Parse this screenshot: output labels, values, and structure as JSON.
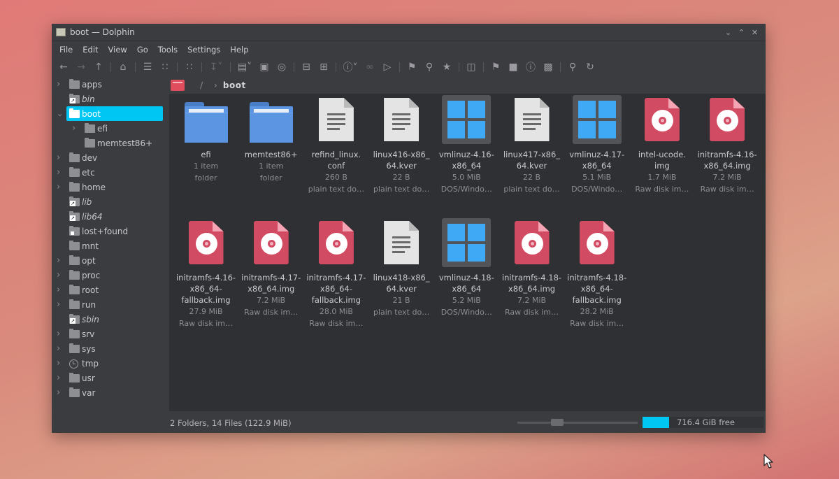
{
  "window": {
    "title": "boot — Dolphin"
  },
  "menu": [
    "File",
    "Edit",
    "View",
    "Go",
    "Tools",
    "Settings",
    "Help"
  ],
  "tree": [
    {
      "label": "apps",
      "expandable": true
    },
    {
      "label": "bin",
      "expandable": false,
      "italic": true
    },
    {
      "label": "boot",
      "expandable": true,
      "selected": true
    },
    {
      "label": "efi",
      "expandable": true,
      "child": true
    },
    {
      "label": "memtest86+",
      "expandable": false,
      "child": true
    },
    {
      "label": "dev",
      "expandable": true
    },
    {
      "label": "etc",
      "expandable": true
    },
    {
      "label": "home",
      "expandable": true
    },
    {
      "label": "lib",
      "expandable": false,
      "italic": true
    },
    {
      "label": "lib64",
      "expandable": false,
      "italic": true
    },
    {
      "label": "lost+found",
      "expandable": false
    },
    {
      "label": "mnt",
      "expandable": false
    },
    {
      "label": "opt",
      "expandable": true
    },
    {
      "label": "proc",
      "expandable": true
    },
    {
      "label": "root",
      "expandable": true
    },
    {
      "label": "run",
      "expandable": true
    },
    {
      "label": "sbin",
      "expandable": false,
      "italic": true
    },
    {
      "label": "srv",
      "expandable": true
    },
    {
      "label": "sys",
      "expandable": true
    },
    {
      "label": "tmp",
      "expandable": true
    },
    {
      "label": "usr",
      "expandable": true
    },
    {
      "label": "var",
      "expandable": true
    }
  ],
  "breadcrumb": {
    "separator": "/",
    "current": "boot"
  },
  "files": [
    {
      "name": [
        "efi"
      ],
      "size": "1 item",
      "type": "folder",
      "icon": "folder"
    },
    {
      "name": [
        "memtest86+"
      ],
      "size": "1 item",
      "type": "folder",
      "icon": "folder"
    },
    {
      "name": [
        "refind_linux.",
        "conf"
      ],
      "size": "260 B",
      "type": "plain text do…",
      "icon": "text"
    },
    {
      "name": [
        "linux416-x86_",
        "64.kver"
      ],
      "size": "22 B",
      "type": "plain text do…",
      "icon": "text"
    },
    {
      "name": [
        "vmlinuz-4.16-",
        "x86_64"
      ],
      "size": "5.0 MiB",
      "type": "DOS/Windo…",
      "icon": "windows"
    },
    {
      "name": [
        "linux417-x86_",
        "64.kver"
      ],
      "size": "22 B",
      "type": "plain text do…",
      "icon": "text"
    },
    {
      "name": [
        "vmlinuz-4.17-",
        "x86_64"
      ],
      "size": "5.1 MiB",
      "type": "DOS/Windo…",
      "icon": "windows"
    },
    {
      "name": [
        "intel-ucode.",
        "img"
      ],
      "size": "1.7 MiB",
      "type": "Raw disk im…",
      "icon": "disk"
    },
    {
      "name": [
        "initramfs-4.16-",
        "x86_64.img"
      ],
      "size": "7.2 MiB",
      "type": "Raw disk im…",
      "icon": "disk"
    },
    {
      "name": [
        "initramfs-4.16-",
        "x86_64-",
        "fallback.img"
      ],
      "size": "27.9 MiB",
      "type": "Raw disk im…",
      "icon": "disk"
    },
    {
      "name": [
        "initramfs-4.17-",
        "x86_64.img"
      ],
      "size": "7.2 MiB",
      "type": "Raw disk im…",
      "icon": "disk"
    },
    {
      "name": [
        "initramfs-4.17-",
        "x86_64-",
        "fallback.img"
      ],
      "size": "28.0 MiB",
      "type": "Raw disk im…",
      "icon": "disk"
    },
    {
      "name": [
        "linux418-x86_",
        "64.kver"
      ],
      "size": "21 B",
      "type": "plain text do…",
      "icon": "text"
    },
    {
      "name": [
        "vmlinuz-4.18-",
        "x86_64"
      ],
      "size": "5.2 MiB",
      "type": "DOS/Windo…",
      "icon": "windows"
    },
    {
      "name": [
        "initramfs-4.18-",
        "x86_64.img"
      ],
      "size": "7.2 MiB",
      "type": "Raw disk im…",
      "icon": "disk"
    },
    {
      "name": [
        "initramfs-4.18-",
        "x86_64-",
        "fallback.img"
      ],
      "size": "28.2 MiB",
      "type": "Raw disk im…",
      "icon": "disk"
    }
  ],
  "status": {
    "summary": "2 Folders, 14 Files (122.9 MiB)",
    "free_space": "716.4 GiB free",
    "used_fraction": 0.22
  },
  "colors": {
    "accent": "#00c6f3",
    "folder": "#5c95e2",
    "disk": "#d14b62",
    "windows": "#3fa9f5"
  }
}
